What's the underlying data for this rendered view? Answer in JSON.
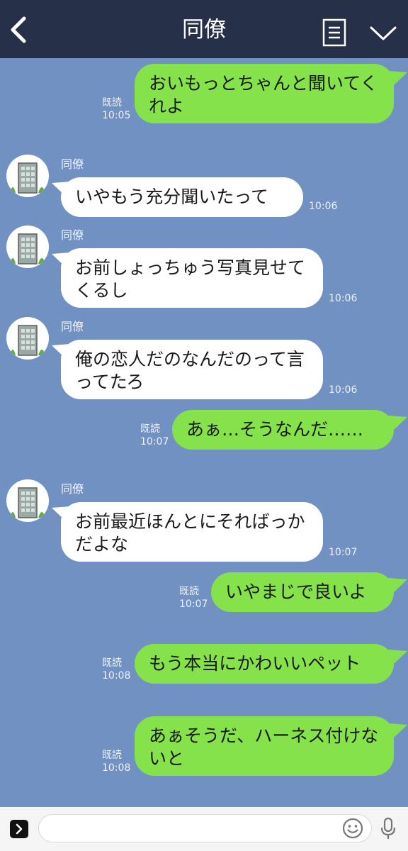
{
  "header": {
    "title": "同僚"
  },
  "contact": {
    "name": "同僚"
  },
  "messages": [
    {
      "side": "out",
      "text": "おいもっとちゃんと聞いてくれよ",
      "read": "既読",
      "time": "10:05"
    },
    {
      "side": "in",
      "name": "同僚",
      "text": "いやもう充分聞いたって",
      "time": "10:06"
    },
    {
      "side": "in",
      "name": "同僚",
      "text": "お前しょっちゅう写真見せてくるし",
      "time": "10:06"
    },
    {
      "side": "in",
      "name": "同僚",
      "text": "俺の恋人だのなんだのって言ってたろ",
      "time": "10:06"
    },
    {
      "side": "out",
      "text": "あぁ…そうなんだ……",
      "read": "既読",
      "time": "10:07"
    },
    {
      "side": "in",
      "name": "同僚",
      "text": "お前最近ほんとにそればっかだよな",
      "time": "10:07"
    },
    {
      "side": "out",
      "text": "いやまじで良いよ",
      "read": "既読",
      "time": "10:07"
    },
    {
      "side": "out",
      "text": "もう本当にかわいいペット",
      "read": "既読",
      "time": "10:08"
    },
    {
      "side": "out",
      "text": "あぁそうだ、ハーネス付けないと",
      "read": "既読",
      "time": "10:08"
    }
  ],
  "colors": {
    "background": "#7291c3",
    "header": "#263149",
    "outgoing_bubble": "#85e24b",
    "incoming_bubble": "#ffffff"
  },
  "icons": [
    "back-icon",
    "menu-list-icon",
    "chevron-down-icon",
    "expand-icon",
    "smile-icon",
    "microphone-icon",
    "building-avatar-icon"
  ]
}
